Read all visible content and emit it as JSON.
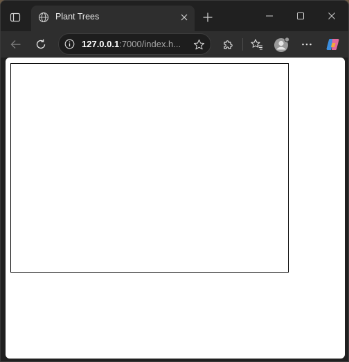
{
  "tab": {
    "title": "Plant Trees",
    "favicon": "globe-icon"
  },
  "address": {
    "host": "127.0.0.1",
    "rest": ":7000/index.h..."
  },
  "icons": {
    "tab_actions": "tab-actions-icon",
    "close_tab": "close-icon",
    "new_tab": "plus-icon",
    "minimize": "minimize-icon",
    "maximize": "maximize-icon",
    "close_window": "close-icon",
    "back": "arrow-left-icon",
    "reload": "reload-icon",
    "site_info": "info-icon",
    "favorite": "star-icon",
    "extensions": "puzzle-icon",
    "favorites": "favorites-icon",
    "profile": "avatar",
    "more": "more-icon",
    "copilot": "copilot-icon"
  },
  "colors": {
    "frame": "#202020",
    "toolbar": "#2e2e2e",
    "page": "#ffffff",
    "canvas_border": "#000000"
  }
}
